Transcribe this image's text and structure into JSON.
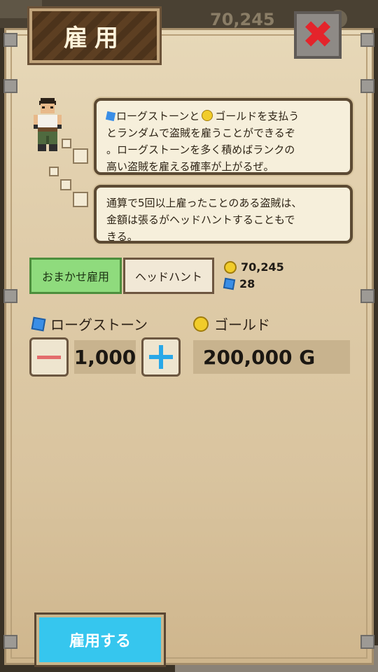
{
  "background": {
    "gold_amount": "70,245"
  },
  "title": "雇用",
  "close_glyph": "✖",
  "dialog": {
    "bubble1": {
      "line1": "ローグストーンと",
      "line1b": "ゴールドを支払う",
      "line2": "とランダムで盗賊を雇うことができるぞ",
      "line3": "。ローグストーンを多く積めばランクの",
      "line4": "高い盗賊を雇える確率が上がるぜ。"
    },
    "bubble2": {
      "line1": "通算で5回以上雇ったことのある盗賊は、",
      "line2": "金額は張るがヘッドハントすることもで",
      "line3": "きる。"
    }
  },
  "tabs": {
    "auto": "おまかせ雇用",
    "headhunt": "ヘッドハント"
  },
  "resources": {
    "gold": "70,245",
    "gems": "28"
  },
  "rogue_stone_label": "ローグストーン",
  "gold_label": "ゴールド",
  "quantity": "1,000",
  "cost": "200,000 G",
  "hire_button": "雇用する",
  "colors": {
    "hire_button": "#36c6ee",
    "active_tab": "#8fdb7d",
    "gem": "#3a8ee6",
    "coin": "#f1cc2a"
  }
}
